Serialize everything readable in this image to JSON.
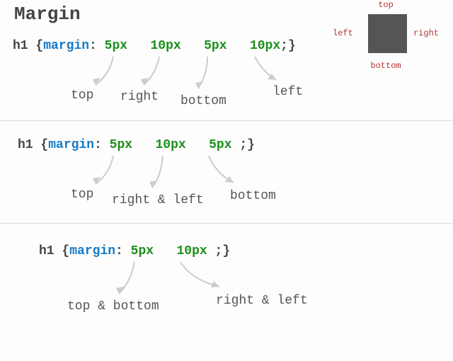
{
  "title": "Margin",
  "box": {
    "top": "top",
    "right": "right",
    "bottom": "bottom",
    "left": "left"
  },
  "examples": [
    {
      "selector": "h1",
      "property": "margin",
      "values": [
        "5px",
        "10px",
        "5px",
        "10px"
      ],
      "annotations": [
        "top",
        "right",
        "bottom",
        "left"
      ]
    },
    {
      "selector": "h1",
      "property": "margin",
      "values": [
        "5px",
        "10px",
        "5px"
      ],
      "annotations": [
        "top",
        "right & left",
        "bottom"
      ]
    },
    {
      "selector": "h1",
      "property": "margin",
      "values": [
        "5px",
        "10px"
      ],
      "annotations": [
        "top & bottom",
        "right & left"
      ]
    }
  ]
}
